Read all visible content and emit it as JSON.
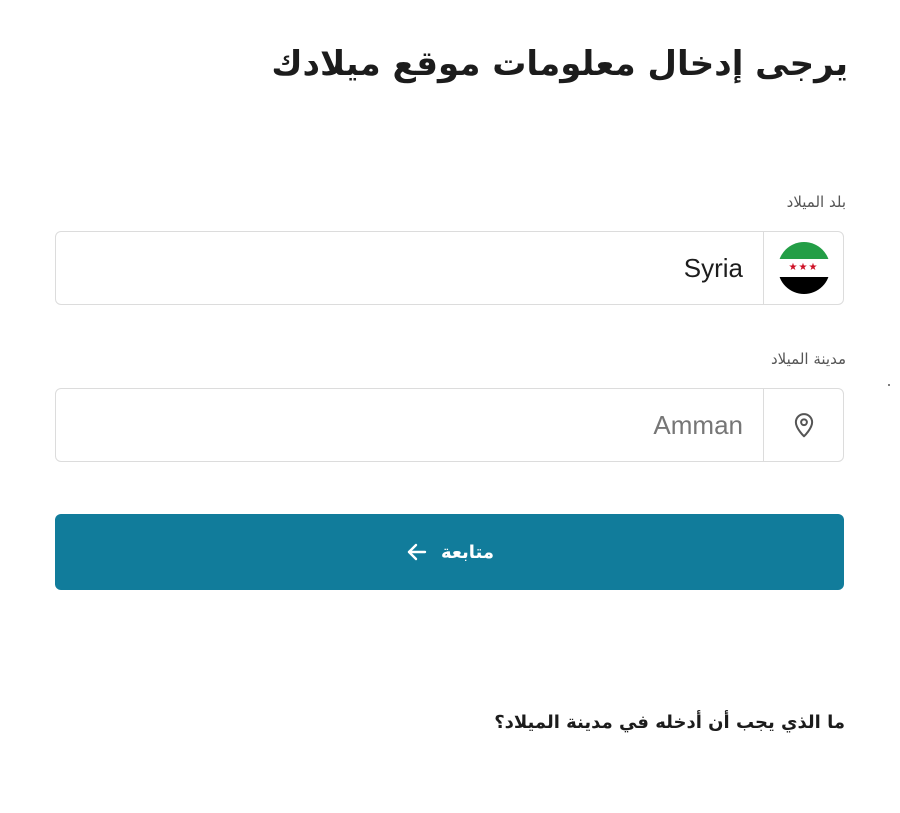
{
  "page": {
    "title": "يرجى إدخال معلومات موقع ميلادك"
  },
  "birth_country": {
    "label": "بلد الميلاد",
    "value": "Syria",
    "flag_icon": "syria-independence-flag-icon",
    "flag_stars": "★★★",
    "flag_colors": [
      "#239e46",
      "#ffffff",
      "#000000",
      "#ce1126"
    ]
  },
  "birth_city": {
    "label": "مدينة الميلاد",
    "placeholder": "Amman",
    "value": "",
    "icon": "map-pin-icon"
  },
  "continue_button": {
    "label": "متابعة",
    "icon": "arrow-left-icon",
    "color": "#117c9b"
  },
  "help": {
    "question": "ما الذي يجب أن أدخله في مدينة الميلاد؟"
  }
}
